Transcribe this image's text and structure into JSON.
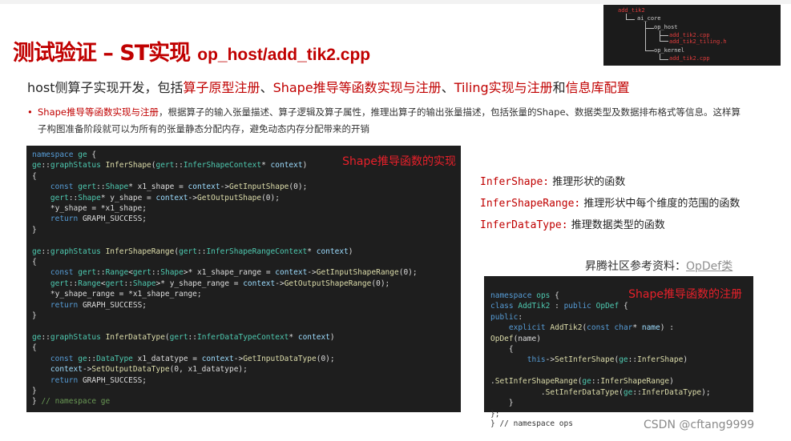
{
  "title": {
    "main": "测试验证 – ST实现",
    "sub": "op_host/add_tik2.cpp"
  },
  "file_tree": {
    "root": "add_tik2",
    "dir1": "ai_core",
    "dir2": "op_host",
    "file1": "add_tik2.cpp",
    "file2": "add_tik2_tiling.h",
    "dir3": "op_kernel",
    "file3": "add_tik2.cpp"
  },
  "intro": {
    "prefix": "host侧算子实现开发，包括",
    "item1": "算子原型注册",
    "sep1": "、",
    "item2": "Shape推导等函数实现与注册",
    "sep2": "、",
    "item3": "Tiling实现与注册",
    "mid": "和",
    "item4": "信息库配置"
  },
  "bullet": {
    "marker": "•",
    "highlight": "Shape推导等函数实现与注册",
    "text": "，根据算子的输入张量描述、算子逻辑及算子属性，推理出算子的输出张量描述，包括张量的Shape、数据类型及数据排布格式等信息。这样算子构图准备阶段就可以为所有的张量静态分配内存，避免动态内存分配带来的开销"
  },
  "code_box_1": {
    "label": "Shape推导函数的实现"
  },
  "code_box_2": {
    "label": "Shape推导函数的注册",
    "tail": "};\n} // namespace ops"
  },
  "definitions": [
    {
      "term": "InferShape:",
      "desc": "推理形状的函数"
    },
    {
      "term": "InferShapeRange:",
      "desc": "推理形状中每个维度的范围的函数"
    },
    {
      "term": "InferDataType:",
      "desc": "推理数据类型的函数"
    }
  ],
  "reference": {
    "prefix": "昇腾社区参考资料：",
    "link": "OpDef类"
  },
  "watermark": "CSDN @cftang9999",
  "colors": {
    "accent_red": "#c00000",
    "code_bg": "#1e1e1e",
    "label_red": "#e8202a"
  }
}
